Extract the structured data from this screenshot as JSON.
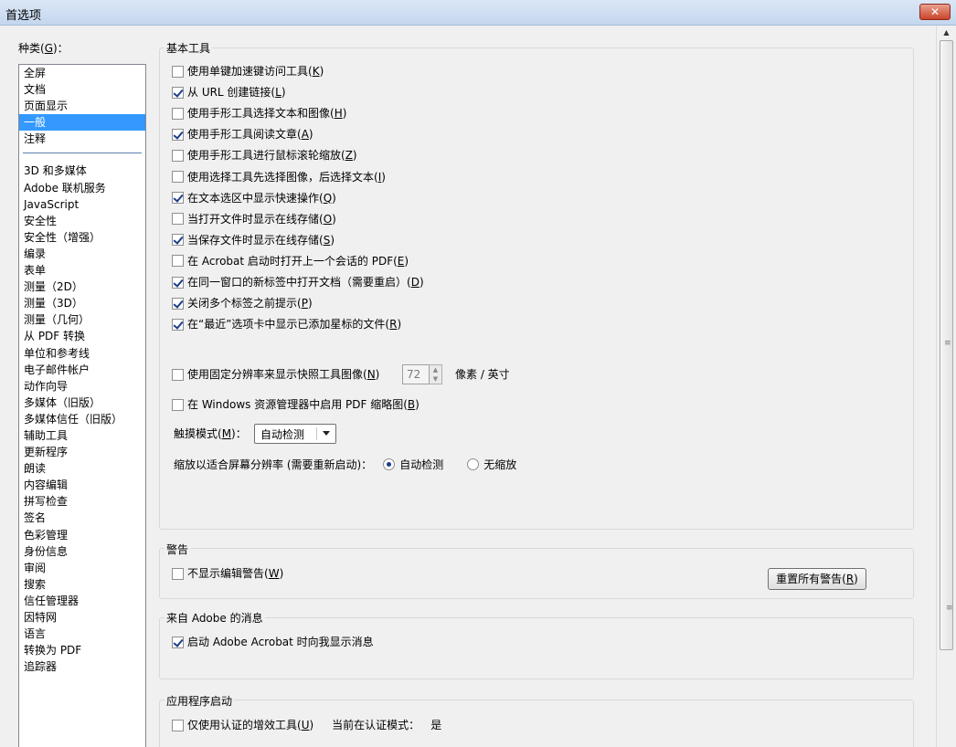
{
  "window": {
    "title": "首选项",
    "close_label": "✕"
  },
  "categories": {
    "label_prefix": "种类(",
    "label_key": "G",
    "label_suffix": ")：",
    "items": [
      "全屏",
      "文档",
      "页面显示",
      "一般",
      "注释"
    ],
    "items2": [
      "3D 和多媒体",
      "Adobe 联机服务",
      "JavaScript",
      "安全性",
      "安全性（增强）",
      "编录",
      "表单",
      "测量（2D）",
      "测量（3D）",
      "测量（几何）",
      "从 PDF 转换",
      "单位和参考线",
      "电子邮件帐户",
      "动作向导",
      "多媒体（旧版）",
      "多媒体信任（旧版）",
      "辅助工具",
      "更新程序",
      "朗读",
      "内容编辑",
      "拼写检查",
      "签名",
      "色彩管理",
      "身份信息",
      "审阅",
      "搜索",
      "信任管理器",
      "因特网",
      "语言",
      "转换为 PDF",
      "追踪器"
    ],
    "selected": "一般"
  },
  "basic_tools": {
    "title": "基本工具",
    "options": [
      {
        "label": "使用单键加速键访问工具(",
        "key": "K",
        "suffix": ")",
        "checked": false
      },
      {
        "label": "从 URL 创建链接(",
        "key": "L",
        "suffix": ")",
        "checked": true
      },
      {
        "label": "使用手形工具选择文本和图像(",
        "key": "H",
        "suffix": ")",
        "checked": false
      },
      {
        "label": "使用手形工具阅读文章(",
        "key": "A",
        "suffix": ")",
        "checked": true
      },
      {
        "label": "使用手形工具进行鼠标滚轮缩放(",
        "key": "Z",
        "suffix": ")",
        "checked": false
      },
      {
        "label": "使用选择工具先选择图像，后选择文本(",
        "key": "I",
        "suffix": ")",
        "checked": false
      },
      {
        "label": "在文本选区中显示快速操作(",
        "key": "Q",
        "suffix": ")",
        "checked": true
      },
      {
        "label": "当打开文件时显示在线存储(",
        "key": "O",
        "suffix": ")",
        "checked": false
      },
      {
        "label": "当保存文件时显示在线存储(",
        "key": "S",
        "suffix": ")",
        "checked": true
      },
      {
        "label": "在 Acrobat 启动时打开上一个会话的 PDF(",
        "key": "E",
        "suffix": ")",
        "checked": false
      },
      {
        "label": "在同一窗口的新标签中打开文档（需要重启）(",
        "key": "D",
        "suffix": ")",
        "checked": true
      },
      {
        "label": "关闭多个标签之前提示(",
        "key": "P",
        "suffix": ")",
        "checked": true
      },
      {
        "label": "在“最近”选项卡中显示已添加星标的文件(",
        "key": "R",
        "suffix": ")",
        "checked": true
      }
    ],
    "fixed_res": {
      "label": "使用固定分辨率来显示快照工具图像(",
      "key": "N",
      "suffix": ")",
      "checked": false,
      "value": "72",
      "unit": "像素 / 英寸"
    },
    "thumbnails": {
      "label": "在 Windows 资源管理器中启用 PDF 缩略图(",
      "key": "B",
      "suffix": ")",
      "checked": false
    },
    "touch_mode": {
      "label_prefix": "触摸模式(",
      "key": "M",
      "label_suffix": ")：",
      "value": "自动检测"
    },
    "scale": {
      "label": "缩放以适合屏幕分辨率 (需要重新启动)：",
      "option_auto": "自动检测",
      "option_none": "无缩放",
      "selected": "auto"
    }
  },
  "warnings": {
    "title": "警告",
    "no_edit_warning": {
      "label": "不显示编辑警告(",
      "key": "W",
      "suffix": ")",
      "checked": false
    },
    "reset_button": {
      "label": "重置所有警告(",
      "key": "R",
      "suffix": ")"
    }
  },
  "adobe_messages": {
    "title": "来自 Adobe 的消息",
    "show_messages": {
      "label": "启动 Adobe Acrobat 时向我显示消息",
      "checked": true
    }
  },
  "app_startup": {
    "title": "应用程序启动",
    "certified_only": {
      "label": "仅使用认证的增效工具(",
      "key": "U",
      "suffix": ")",
      "checked": false
    },
    "certified_mode_label": "当前在认证模式：",
    "certified_mode_value": "是"
  }
}
